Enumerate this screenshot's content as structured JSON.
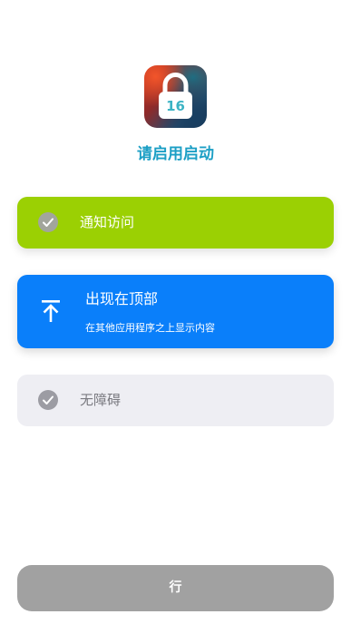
{
  "app_icon": {
    "icon": "lock-icon",
    "number": "16"
  },
  "page_title": "请启用启动",
  "permissions": {
    "notification": {
      "label": "通知访问",
      "icon": "checkmark-icon",
      "color": "#9bd003"
    },
    "overlay": {
      "title": "出现在顶部",
      "subtitle": "在其他应用程序之上显示内容",
      "icon": "arrow-to-top-icon",
      "color": "#0a7ffa"
    },
    "accessibility": {
      "label": "无障碍",
      "icon": "checkmark-icon",
      "color": "#eeeef3"
    }
  },
  "action_button": {
    "label": "行",
    "color": "#a1a1a1"
  },
  "colors": {
    "title": "#1c9fc5"
  }
}
